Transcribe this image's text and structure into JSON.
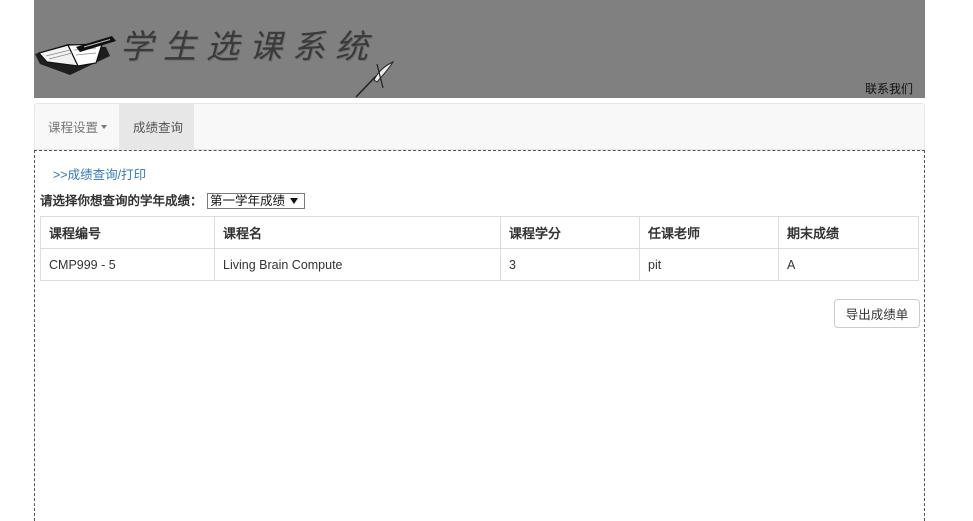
{
  "header": {
    "logo_text": "学生选课系统",
    "contact_label": "联系我们"
  },
  "navbar": {
    "items": [
      {
        "label": "课程设置",
        "icon": "caret-down-icon",
        "has_dropdown": true,
        "active": false
      },
      {
        "label": "成绩查询",
        "has_dropdown": false,
        "active": true
      }
    ]
  },
  "content": {
    "breadcrumb_link": ">>成绩查询/打印",
    "year_select": {
      "label": "请选择你想查询的学年成绩：",
      "value": "第一学年成绩",
      "icon": "caret-down-icon"
    },
    "grades_table": {
      "headers": [
        "课程编号",
        "课程名",
        "课程学分",
        "任课老师",
        "期末成绩"
      ],
      "rows": [
        [
          "CMP999 - 5",
          "Living Brain Compute",
          "3",
          "pit",
          "A"
        ]
      ]
    },
    "export_button_label": "导出成绩单"
  },
  "icons": {
    "logo_book": "open-book-icon",
    "logo_quill": "quill-pen-icon"
  },
  "colors": {
    "banner_background": "#808080",
    "logo_text": "#3a3a3a",
    "navbar_background": "#f8f8f8",
    "navbar_active_background": "#e7e7e7",
    "link": "#337ab7",
    "table_border": "#dddddd",
    "panel_border": "#555555"
  }
}
